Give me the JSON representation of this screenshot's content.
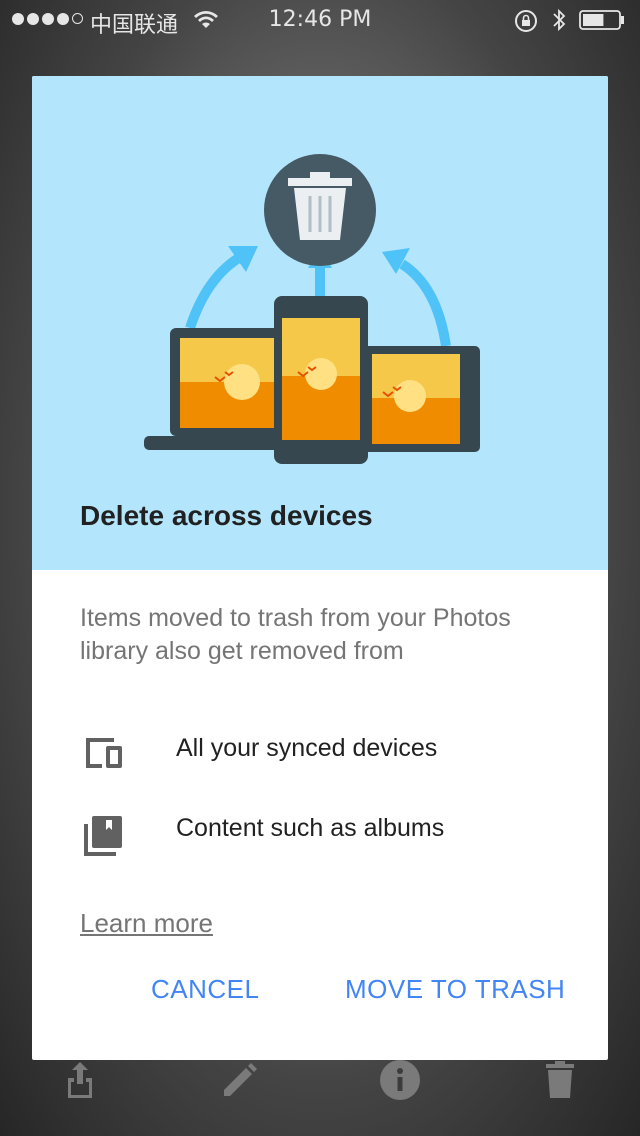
{
  "status_bar": {
    "carrier": "中国联通",
    "time": "12:46 PM",
    "signal_dots_filled": 4,
    "signal_dots_total": 5,
    "battery_level": 0.6
  },
  "dialog": {
    "title": "Delete across devices",
    "body": "Items moved to trash from your Photos library also get removed from",
    "items": [
      {
        "icon": "devices-icon",
        "label": "All your synced devices"
      },
      {
        "icon": "albums-icon",
        "label": "Content such as albums"
      }
    ],
    "learn_more": "Learn more",
    "cancel_label": "CANCEL",
    "confirm_label": "MOVE TO TRASH",
    "colors": {
      "hero_background": "#b3e5fc",
      "accent": "#4285f4",
      "arrow": "#4fc3f7",
      "trash_circle": "#455a64",
      "sun_sky": "#f6c84a",
      "sun_sea": "#f08c00"
    }
  },
  "toolbar": {
    "icons": [
      "share-icon",
      "edit-icon",
      "info-icon",
      "delete-icon"
    ]
  }
}
